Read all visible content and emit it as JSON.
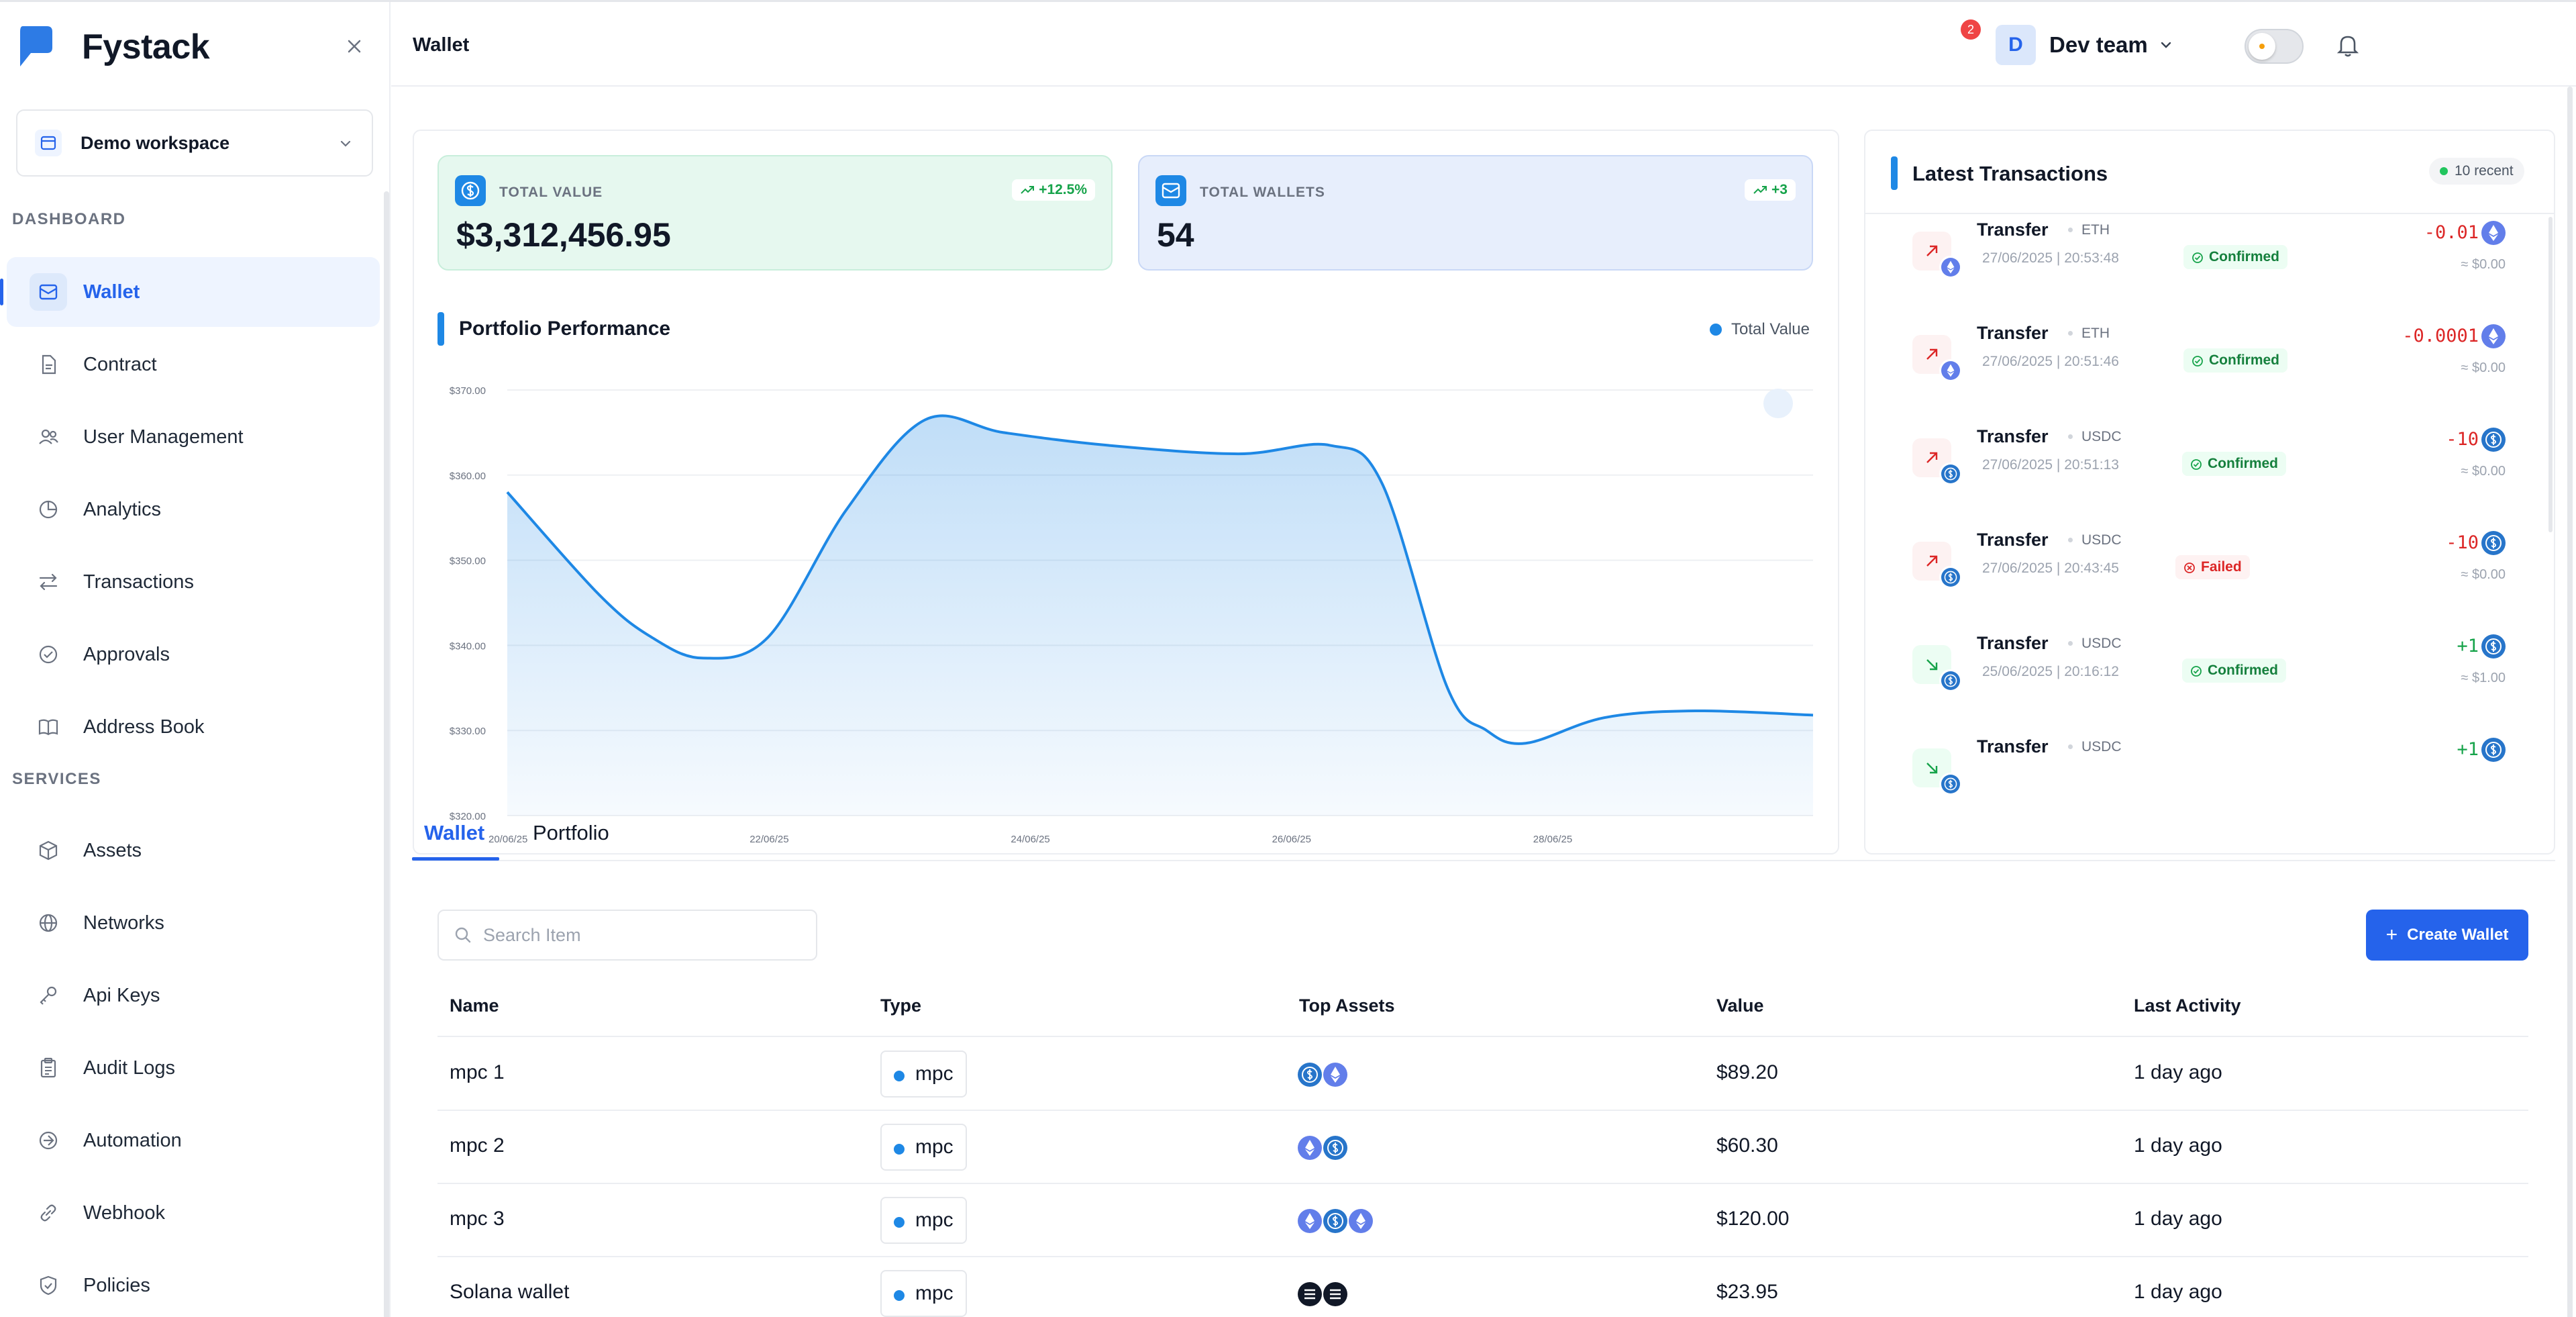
{
  "app": {
    "brand": "Fystack"
  },
  "workspace": {
    "label": "Demo workspace"
  },
  "sidebar": {
    "sections": {
      "dashboard": "DASHBOARD",
      "services": "SERVICES"
    },
    "items": [
      {
        "label": "Wallet",
        "icon": "wallet-icon"
      },
      {
        "label": "Contract",
        "icon": "document-icon"
      },
      {
        "label": "User Management",
        "icon": "users-icon"
      },
      {
        "label": "Analytics",
        "icon": "chart-icon"
      },
      {
        "label": "Transactions",
        "icon": "arrows-icon"
      },
      {
        "label": "Approvals",
        "icon": "check-circle-icon"
      },
      {
        "label": "Address Book",
        "icon": "book-icon"
      },
      {
        "label": "Assets",
        "icon": "cube-icon"
      },
      {
        "label": "Networks",
        "icon": "globe-icon"
      },
      {
        "label": "Api Keys",
        "icon": "key-icon"
      },
      {
        "label": "Audit Logs",
        "icon": "clipboard-icon"
      },
      {
        "label": "Automation",
        "icon": "automation-icon"
      },
      {
        "label": "Webhook",
        "icon": "link-icon"
      },
      {
        "label": "Policies",
        "icon": "shield-icon"
      }
    ]
  },
  "header": {
    "title": "Wallet",
    "notifications": "2",
    "user": {
      "initial": "D",
      "name": "Dev team"
    }
  },
  "stats": {
    "total_value": {
      "label": "TOTAL VALUE",
      "value": "$3,312,456.95",
      "change": "+12.5%"
    },
    "total_wallets": {
      "label": "TOTAL WALLETS",
      "value": "54",
      "change": "+3"
    }
  },
  "chart_data": {
    "type": "area",
    "title": "Portfolio Performance",
    "legend": [
      "Total Value"
    ],
    "legend_position": "top-right",
    "x_labels": [
      "20/06/25",
      "22/06/25",
      "24/06/25",
      "26/06/25",
      "28/06/25"
    ],
    "y_ticks": [
      "$370.00",
      "$360.00",
      "$350.00",
      "$340.00",
      "$330.00",
      "$320.00"
    ],
    "ylim": [
      320,
      370
    ],
    "grid": true,
    "color": "#1e88e5",
    "series": [
      {
        "name": "Total Value",
        "points": [
          [
            0,
            358
          ],
          [
            0.35,
            346
          ],
          [
            0.55,
            341
          ],
          [
            0.75,
            338.5
          ],
          [
            1.0,
            341
          ],
          [
            1.3,
            356
          ],
          [
            1.6,
            366.5
          ],
          [
            1.9,
            365
          ],
          [
            2.3,
            363.5
          ],
          [
            2.8,
            362.5
          ],
          [
            3.15,
            363.5
          ],
          [
            3.35,
            359
          ],
          [
            3.6,
            335
          ],
          [
            3.75,
            330
          ],
          [
            3.9,
            328.5
          ],
          [
            4.2,
            331.5
          ],
          [
            4.55,
            332.3
          ],
          [
            5.0,
            331.8
          ]
        ]
      }
    ]
  },
  "transactions": {
    "title": "Latest Transactions",
    "recent": "10 recent",
    "items": [
      {
        "type": "Transfer",
        "asset": "ETH",
        "time": "27/06/2025 | 20:53:48",
        "status": "Confirmed",
        "amount": "-0.01",
        "usd": "≈ $0.00",
        "dir": "out",
        "coin": "eth"
      },
      {
        "type": "Transfer",
        "asset": "ETH",
        "time": "27/06/2025 | 20:51:46",
        "status": "Confirmed",
        "amount": "-0.0001",
        "usd": "≈ $0.00",
        "dir": "out",
        "coin": "eth"
      },
      {
        "type": "Transfer",
        "asset": "USDC",
        "time": "27/06/2025 | 20:51:13",
        "status": "Confirmed",
        "amount": "-10",
        "usd": "≈ $0.00",
        "dir": "out",
        "coin": "usdc"
      },
      {
        "type": "Transfer",
        "asset": "USDC",
        "time": "27/06/2025 | 20:43:45",
        "status": "Failed",
        "amount": "-10",
        "usd": "≈ $0.00",
        "dir": "out",
        "coin": "usdc"
      },
      {
        "type": "Transfer",
        "asset": "USDC",
        "time": "25/06/2025 | 20:16:12",
        "status": "Confirmed",
        "amount": "+1",
        "usd": "≈ $1.00",
        "dir": "in",
        "coin": "usdc"
      },
      {
        "type": "Transfer",
        "asset": "USDC",
        "time": "",
        "status": "",
        "amount": "+1",
        "usd": "",
        "dir": "in",
        "coin": "usdc"
      }
    ]
  },
  "tabs": [
    {
      "label": "Wallet"
    },
    {
      "label": "Portfolio"
    }
  ],
  "wallets": {
    "search_placeholder": "Search Item",
    "create_label": "Create Wallet",
    "columns": [
      "Name",
      "Type",
      "Top Assets",
      "Value",
      "Last Activity"
    ],
    "rows": [
      {
        "name": "mpc 1",
        "type": "mpc",
        "assets": [
          "usdc",
          "eth"
        ],
        "value": "$89.20",
        "activity": "1 day ago"
      },
      {
        "name": "mpc 2",
        "type": "mpc",
        "assets": [
          "eth",
          "usdc"
        ],
        "value": "$60.30",
        "activity": "1 day ago"
      },
      {
        "name": "mpc 3",
        "type": "mpc",
        "assets": [
          "eth",
          "usdc",
          "eth"
        ],
        "value": "$120.00",
        "activity": "1 day ago"
      },
      {
        "name": "Solana wallet",
        "type": "mpc",
        "assets": [
          "sol",
          "sol"
        ],
        "value": "$23.95",
        "activity": "1 day ago"
      }
    ]
  },
  "colors": {
    "accent": "#2563eb",
    "chart": "#1e88e5",
    "positive": "#16a34a",
    "negative": "#dc2626"
  }
}
